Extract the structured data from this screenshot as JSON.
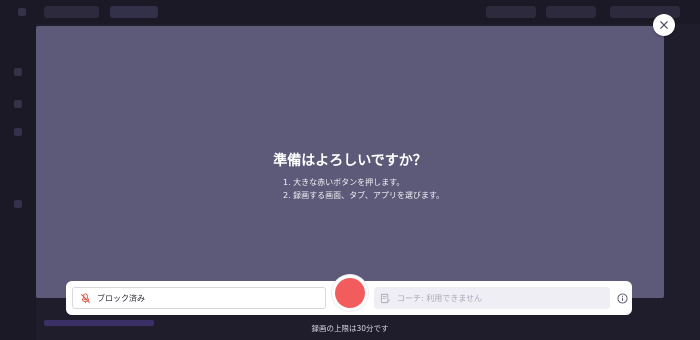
{
  "overlay": {
    "title": "準備はよろしいですか？",
    "steps": [
      "1. 大きな赤いボタンを押します。",
      "2. 録画する画面、タブ、アプリを選びます。"
    ]
  },
  "controls": {
    "mic_label": "ブロック済み",
    "coach_placeholder": "コーチ: 利用できません",
    "record_color": "#f25c5c",
    "limit_text": "録画の上限は30分です"
  },
  "icons": {
    "close": "close-icon",
    "mic": "mic-blocked-icon",
    "coach": "coach-notes-icon",
    "info": "info-icon"
  }
}
